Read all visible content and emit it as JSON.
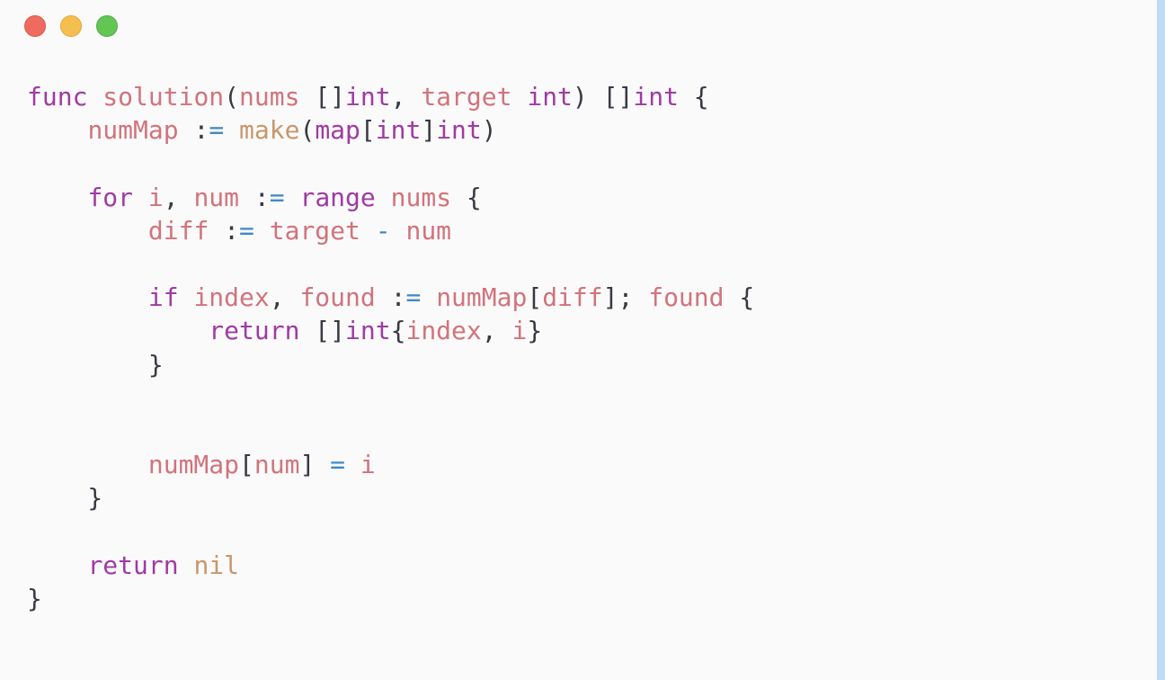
{
  "window": {
    "controls": [
      {
        "name": "close",
        "color": "#ef6b60"
      },
      {
        "name": "minimize",
        "color": "#f5bf4f"
      },
      {
        "name": "maximize",
        "color": "#62c554"
      }
    ]
  },
  "editor": {
    "language": "go",
    "colors": {
      "keyword": "#a03aa3",
      "identifier": "#d2737c",
      "operator": "#3d89c6",
      "builtin": "#c8976a",
      "punctuation": "#383a42",
      "background": "#fafafa",
      "scrollbar": "#bfdbf6"
    },
    "lines": [
      [
        [
          "kw",
          "func"
        ],
        [
          "pn",
          " "
        ],
        [
          "fn",
          "solution"
        ],
        [
          "pn",
          "("
        ],
        [
          "var",
          "nums"
        ],
        [
          "pn",
          " []"
        ],
        [
          "ty",
          "int"
        ],
        [
          "pn",
          ", "
        ],
        [
          "var",
          "target"
        ],
        [
          "pn",
          " "
        ],
        [
          "ty",
          "int"
        ],
        [
          "pn",
          ") []"
        ],
        [
          "ty",
          "int"
        ],
        [
          "pn",
          " {"
        ]
      ],
      [
        [
          "pn",
          "    "
        ],
        [
          "var",
          "numMap"
        ],
        [
          "pn",
          " :"
        ],
        [
          "op",
          "="
        ],
        [
          "pn",
          " "
        ],
        [
          "builtin",
          "make"
        ],
        [
          "pn",
          "("
        ],
        [
          "ty",
          "map"
        ],
        [
          "pn",
          "["
        ],
        [
          "ty",
          "int"
        ],
        [
          "pn",
          "]"
        ],
        [
          "ty",
          "int"
        ],
        [
          "pn",
          ")"
        ]
      ],
      [],
      [
        [
          "pn",
          "    "
        ],
        [
          "kw",
          "for"
        ],
        [
          "pn",
          " "
        ],
        [
          "var",
          "i"
        ],
        [
          "pn",
          ", "
        ],
        [
          "var",
          "num"
        ],
        [
          "pn",
          " :"
        ],
        [
          "op",
          "="
        ],
        [
          "pn",
          " "
        ],
        [
          "kw",
          "range"
        ],
        [
          "pn",
          " "
        ],
        [
          "var",
          "nums"
        ],
        [
          "pn",
          " {"
        ]
      ],
      [
        [
          "pn",
          "        "
        ],
        [
          "var",
          "diff"
        ],
        [
          "pn",
          " :"
        ],
        [
          "op",
          "="
        ],
        [
          "pn",
          " "
        ],
        [
          "var",
          "target"
        ],
        [
          "pn",
          " "
        ],
        [
          "op",
          "-"
        ],
        [
          "pn",
          " "
        ],
        [
          "var",
          "num"
        ]
      ],
      [],
      [
        [
          "pn",
          "        "
        ],
        [
          "kw",
          "if"
        ],
        [
          "pn",
          " "
        ],
        [
          "var",
          "index"
        ],
        [
          "pn",
          ", "
        ],
        [
          "var",
          "found"
        ],
        [
          "pn",
          " :"
        ],
        [
          "op",
          "="
        ],
        [
          "pn",
          " "
        ],
        [
          "var",
          "numMap"
        ],
        [
          "pn",
          "["
        ],
        [
          "var",
          "diff"
        ],
        [
          "pn",
          "]; "
        ],
        [
          "var",
          "found"
        ],
        [
          "pn",
          " {"
        ]
      ],
      [
        [
          "pn",
          "            "
        ],
        [
          "kw",
          "return"
        ],
        [
          "pn",
          " []"
        ],
        [
          "ty",
          "int"
        ],
        [
          "pn",
          "{"
        ],
        [
          "var",
          "index"
        ],
        [
          "pn",
          ", "
        ],
        [
          "var",
          "i"
        ],
        [
          "pn",
          "}"
        ]
      ],
      [
        [
          "pn",
          "        }"
        ]
      ],
      [],
      [],
      [
        [
          "pn",
          "        "
        ],
        [
          "var",
          "numMap"
        ],
        [
          "pn",
          "["
        ],
        [
          "var",
          "num"
        ],
        [
          "pn",
          "] "
        ],
        [
          "op",
          "="
        ],
        [
          "pn",
          " "
        ],
        [
          "var",
          "i"
        ]
      ],
      [
        [
          "pn",
          "    }"
        ]
      ],
      [],
      [
        [
          "pn",
          "    "
        ],
        [
          "kw",
          "return"
        ],
        [
          "pn",
          " "
        ],
        [
          "builtin",
          "nil"
        ]
      ],
      [
        [
          "pn",
          "}"
        ]
      ]
    ]
  }
}
